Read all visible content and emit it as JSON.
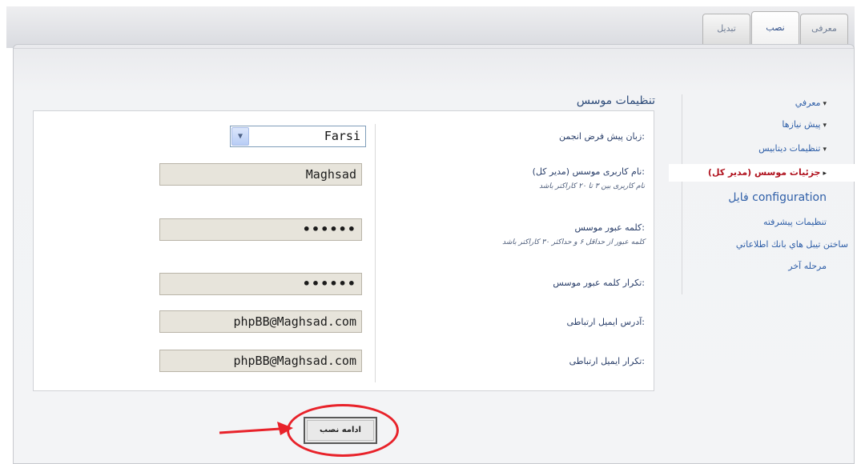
{
  "tabs": [
    {
      "label": "معرفی"
    },
    {
      "label": "نصب"
    },
    {
      "label": "تبدیل"
    }
  ],
  "section_title": "تنظیمات موسس",
  "menu": [
    {
      "label": "معرفي",
      "arrow": "▾"
    },
    {
      "label": "پیش نیازها",
      "arrow": "▾"
    },
    {
      "label": "تنظیمات دیتابیس",
      "arrow": "▾"
    },
    {
      "label": "جزئیات موسس (مدیر کل)",
      "arrow": "▸",
      "active": true
    },
    {
      "label": "فایل configuration"
    },
    {
      "label": "تنظیمات پیشرفته"
    },
    {
      "label": "ساختن تیبل هاي بانك اطلاعاتي"
    },
    {
      "label": "مرحله آخر"
    }
  ],
  "form": {
    "language_label": "زبان پیش فرض انجمن:",
    "language_value": "Farsi",
    "username_label": "نام کاربری موسس (مدیر کل):",
    "username_hint": "نام کاربری بین ۳ تا ۲۰ کاراکتر باشد",
    "username_value": "Maghsad",
    "password_label": "کلمه عبور موسس:",
    "password_hint": "کلمه عبور از حداقل ۶ و حداکثر ۳۰ کاراکتر باشد",
    "password_value": "••••••",
    "password_confirm_label": "تکرار کلمه عبور موسس:",
    "password_confirm_value": "••••••",
    "email_label": "آدرس ایمیل ارتباطی:",
    "email_value": "phpBB@Maghsad.com",
    "email_confirm_label": "تکرار ایمیل ارتباطی:",
    "email_confirm_value": "phpBB@Maghsad.com"
  },
  "continue_button_label": "ادامه نصب",
  "colors": {
    "highlight_red": "#e8222a",
    "active_menu_text": "#b0131f",
    "link_blue": "#2f5fa8"
  }
}
